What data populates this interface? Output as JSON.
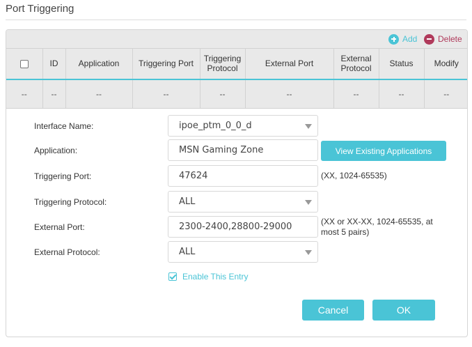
{
  "page": {
    "title": "Port Triggering"
  },
  "toolbar": {
    "add_label": "Add",
    "delete_label": "Delete",
    "add_icon": "plus-circle-icon",
    "delete_icon": "minus-circle-icon",
    "add_color": "#4ac4d6",
    "delete_color": "#b03a5b"
  },
  "table": {
    "columns": [
      "ID",
      "Application",
      "Triggering Port",
      "Triggering Protocol",
      "External Port",
      "External Protocol",
      "Status",
      "Modify"
    ],
    "row": [
      "--",
      "--",
      "--",
      "--",
      "--",
      "--",
      "--",
      "--",
      "--"
    ]
  },
  "form": {
    "interface_name": {
      "label": "Interface Name:",
      "value": "ipoe_ptm_0_0_d"
    },
    "application": {
      "label": "Application:",
      "value": "MSN Gaming Zone",
      "button": "View Existing Applications"
    },
    "triggering_port": {
      "label": "Triggering Port:",
      "value": "47624",
      "hint": "(XX, 1024-65535)"
    },
    "triggering_protocol": {
      "label": "Triggering Protocol:",
      "value": "ALL"
    },
    "external_port": {
      "label": "External Port:",
      "value": "2300-2400,28800-29000",
      "hint_line1": "(XX or XX-XX, 1024-65535, at",
      "hint_line2": "most 5 pairs)"
    },
    "external_protocol": {
      "label": "External Protocol:",
      "value": "ALL"
    },
    "enable_entry": {
      "label": "Enable This Entry",
      "checked": true
    },
    "cancel": "Cancel",
    "ok": "OK"
  },
  "colors": {
    "accent": "#4ac4d6",
    "header_bg": "#e9e9e9"
  }
}
